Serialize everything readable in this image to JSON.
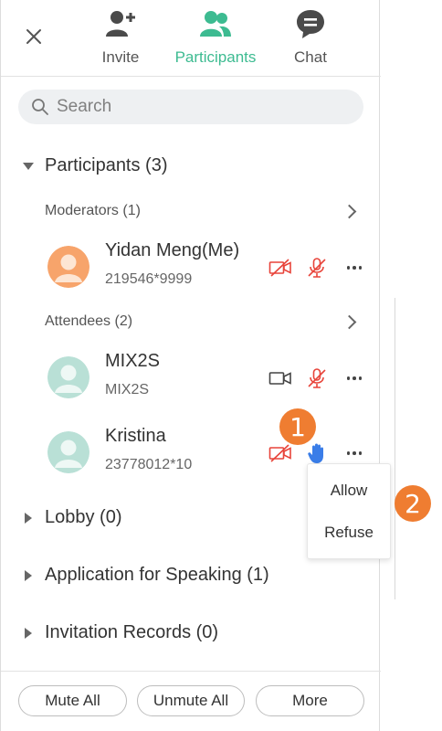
{
  "header": {
    "tabs": [
      {
        "label": "Invite",
        "icon": "add-user-icon"
      },
      {
        "label": "Participants",
        "icon": "participants-icon",
        "active": true
      },
      {
        "label": "Chat",
        "icon": "chat-icon"
      }
    ]
  },
  "search": {
    "placeholder": "Search"
  },
  "participants_section": {
    "label": "Participants (3)"
  },
  "moderators": {
    "label": "Moderators (1)"
  },
  "attendees": {
    "label": "Attendees (2)"
  },
  "rows": [
    {
      "name": "Yidan Meng(Me)",
      "id": "219546*9999",
      "avatar_color": "#f7a46b",
      "camera": "off",
      "mic": "off"
    },
    {
      "name": "MIX2S",
      "id": "MIX2S",
      "avatar_color": "#b9e0d6",
      "camera": "on",
      "mic": "off"
    },
    {
      "name": "Kristina",
      "id": "23778012*10",
      "avatar_color": "#b9e0d6",
      "camera": "off",
      "hand": "raised"
    }
  ],
  "context_menu": {
    "allow": "Allow",
    "refuse": "Refuse"
  },
  "callouts": [
    "1",
    "2"
  ],
  "sections": {
    "lobby": "Lobby (0)",
    "speaking": "Application for Speaking (1)",
    "invitations": "Invitation Records (0)"
  },
  "footer": {
    "mute_all": "Mute All",
    "unmute_all": "Unmute All",
    "more": "More"
  },
  "colors": {
    "accent": "#3dbb91",
    "danger": "#e8443a",
    "hand": "#3a7de8",
    "callout": "#ef7d31"
  }
}
